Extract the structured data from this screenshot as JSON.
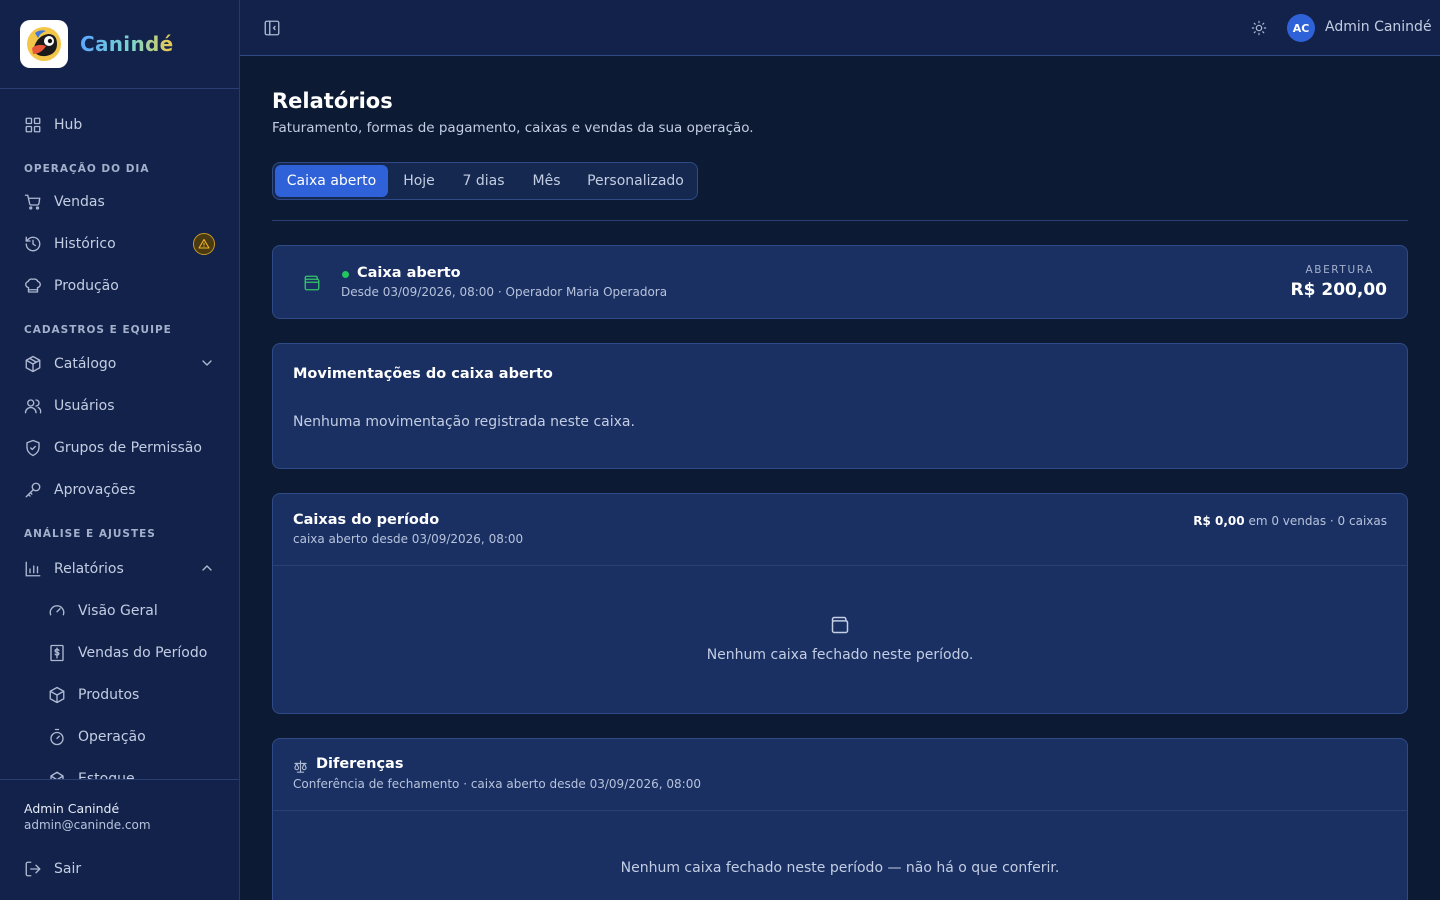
{
  "brand": {
    "name": "Canindé"
  },
  "sidebar": {
    "hub": {
      "label": "Hub",
      "icon": "grid-icon"
    },
    "sections": [
      {
        "label": "OPERAÇÃO DO DIA"
      },
      {
        "label": "CADASTROS E EQUIPE"
      },
      {
        "label": "ANÁLISE E AJUSTES"
      }
    ],
    "items": [
      {
        "label": "Vendas",
        "icon": "cart-icon"
      },
      {
        "label": "Histórico",
        "icon": "history-icon",
        "badge": "warning-icon"
      },
      {
        "label": "Produção",
        "icon": "chef-hat-icon"
      },
      {
        "label": "Catálogo",
        "icon": "package-icon"
      },
      {
        "label": "Usuários",
        "icon": "users-icon"
      },
      {
        "label": "Grupos de Permissão",
        "icon": "shield-check-icon"
      },
      {
        "label": "Aprovações",
        "icon": "key-icon"
      },
      {
        "label": "Relatórios",
        "icon": "bar-chart-icon"
      }
    ],
    "sub_items": [
      {
        "label": "Visão Geral",
        "icon": "gauge-icon"
      },
      {
        "label": "Vendas do Período",
        "icon": "receipt-dollar-icon"
      },
      {
        "label": "Produtos",
        "icon": "package-icon"
      },
      {
        "label": "Operação",
        "icon": "timer-icon"
      },
      {
        "label": "Estoque",
        "icon": "box-icon"
      }
    ],
    "user": {
      "name": "Admin Canindé",
      "email": "admin@caninde.com"
    },
    "logout": {
      "label": "Sair",
      "icon": "logout-icon"
    }
  },
  "topbar": {
    "avatar_initials": "AC",
    "user_name": "Admin Canindé"
  },
  "page": {
    "title": "Relatórios",
    "subtitle": "Faturamento, formas de pagamento, caixas e vendas da sua operação.",
    "tabs": [
      {
        "label": "Caixa aberto",
        "active": true
      },
      {
        "label": "Hoje"
      },
      {
        "label": "7 dias"
      },
      {
        "label": "Mês"
      },
      {
        "label": "Personalizado"
      }
    ]
  },
  "open_register": {
    "title": "Caixa aberto",
    "detail": "Desde 03/09/2026, 08:00 · Operador Maria Operadora",
    "opening_label": "ABERTURA",
    "opening_value": "R$ 200,00",
    "status_color": "#22c55e"
  },
  "movements": {
    "title": "Movimentações do caixa aberto",
    "empty": "Nenhuma movimentação registrada neste caixa."
  },
  "period_registers": {
    "title": "Caixas do período",
    "subtitle": "caixa aberto desde 03/09/2026, 08:00",
    "summary_value": "R$ 0,00",
    "summary_rest": "em 0 vendas · 0 caixas",
    "empty": "Nenhum caixa fechado neste período."
  },
  "differences": {
    "title": "Diferenças",
    "subtitle": "Conferência de fechamento · caixa aberto desde 03/09/2026, 08:00",
    "empty": "Nenhum caixa fechado neste período — não há o que conferir."
  },
  "colors": {
    "accent": "#2f62d8",
    "background": "#0d1a33",
    "panel": "#1a3062",
    "warning": "#c99a22"
  }
}
